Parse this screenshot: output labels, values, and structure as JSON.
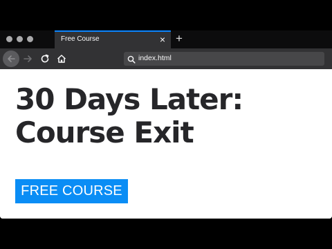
{
  "browser": {
    "tab": {
      "title": "Free Course",
      "close_glyph": "×"
    },
    "new_tab_glyph": "+",
    "url": "index.html",
    "icons": [
      "back-icon",
      "forward-icon",
      "reload-icon",
      "home-icon",
      "search-icon"
    ]
  },
  "page": {
    "headline_line1": "30 Days Later:",
    "headline_line2": "Course Exit",
    "badge": "FREE COURSE"
  },
  "colors": {
    "accent": "#0a84ff",
    "badge_bg": "#0a8df5",
    "headline": "#262629",
    "chrome_dark": "#0c0c0d",
    "chrome": "#323234"
  }
}
